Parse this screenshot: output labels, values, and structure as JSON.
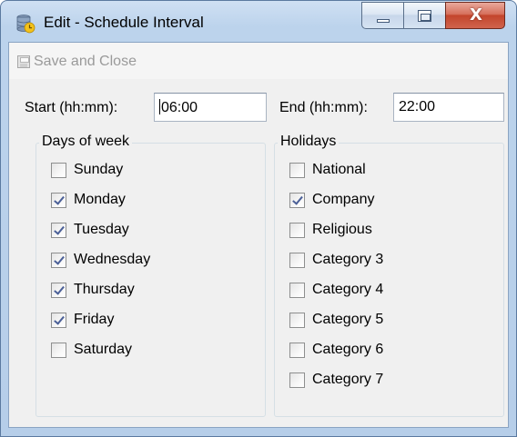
{
  "window": {
    "title": "Edit - Schedule Interval",
    "close_glyph": "X",
    "app_icon": "database-schedule-icon"
  },
  "toolbar": {
    "save_close_label": "Save and Close",
    "save_close_enabled": false
  },
  "interval": {
    "start_label": "Start (hh:mm):",
    "start_value": "06:00",
    "end_label": "End (hh:mm):",
    "end_value": "22:00"
  },
  "days": {
    "title": "Days of week",
    "items": [
      {
        "label": "Sunday",
        "checked": false
      },
      {
        "label": "Monday",
        "checked": true
      },
      {
        "label": "Tuesday",
        "checked": true
      },
      {
        "label": "Wednesday",
        "checked": true
      },
      {
        "label": "Thursday",
        "checked": true
      },
      {
        "label": "Friday",
        "checked": true
      },
      {
        "label": "Saturday",
        "checked": false
      }
    ]
  },
  "holidays": {
    "title": "Holidays",
    "items": [
      {
        "label": "National",
        "checked": false
      },
      {
        "label": "Company",
        "checked": true
      },
      {
        "label": "Religious",
        "checked": false
      },
      {
        "label": "Category 3",
        "checked": false
      },
      {
        "label": "Category 4",
        "checked": false
      },
      {
        "label": "Category 5",
        "checked": false
      },
      {
        "label": "Category 6",
        "checked": false
      },
      {
        "label": "Category 7",
        "checked": false
      }
    ]
  },
  "colors": {
    "title_bar": "#bcd3ec",
    "close_button": "#c3452c",
    "disabled_text": "#9a9a9a",
    "checkmark": "#4a5f97"
  }
}
